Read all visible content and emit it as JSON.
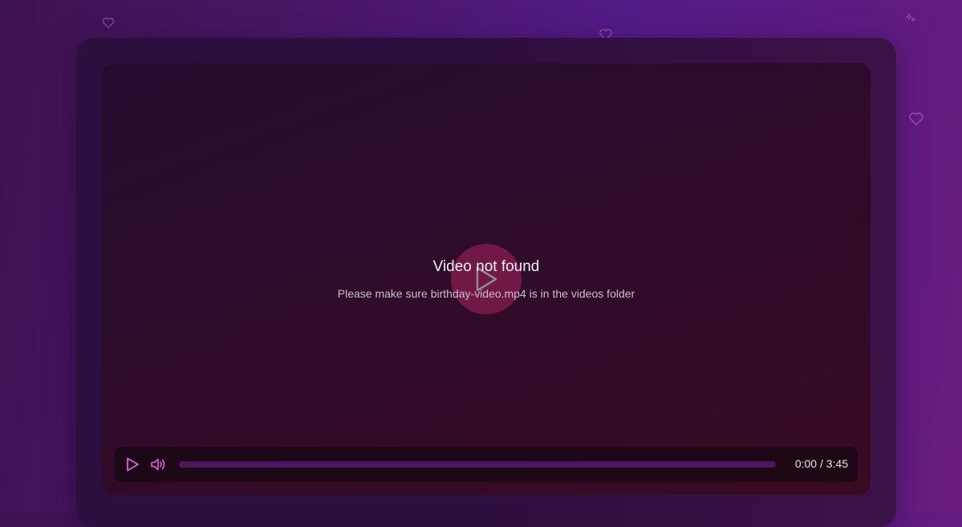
{
  "player": {
    "error_title": "Video not found",
    "error_message": "Please make sure birthday-video.mp4 is in the videos folder",
    "current_time": "0:00",
    "duration": "3:45",
    "time_separator": "/",
    "progress": 0
  },
  "icons": {
    "play_overlay": "play-icon",
    "play_control": "play-icon",
    "volume_control": "volume-icon",
    "decorations": [
      "heart-icon",
      "heart-icon",
      "heart-icon",
      "sparkle-icon"
    ]
  },
  "colors": {
    "accent": "#e060d8",
    "progress_track": "#4c1560",
    "overlay_button": "#821e4b"
  }
}
